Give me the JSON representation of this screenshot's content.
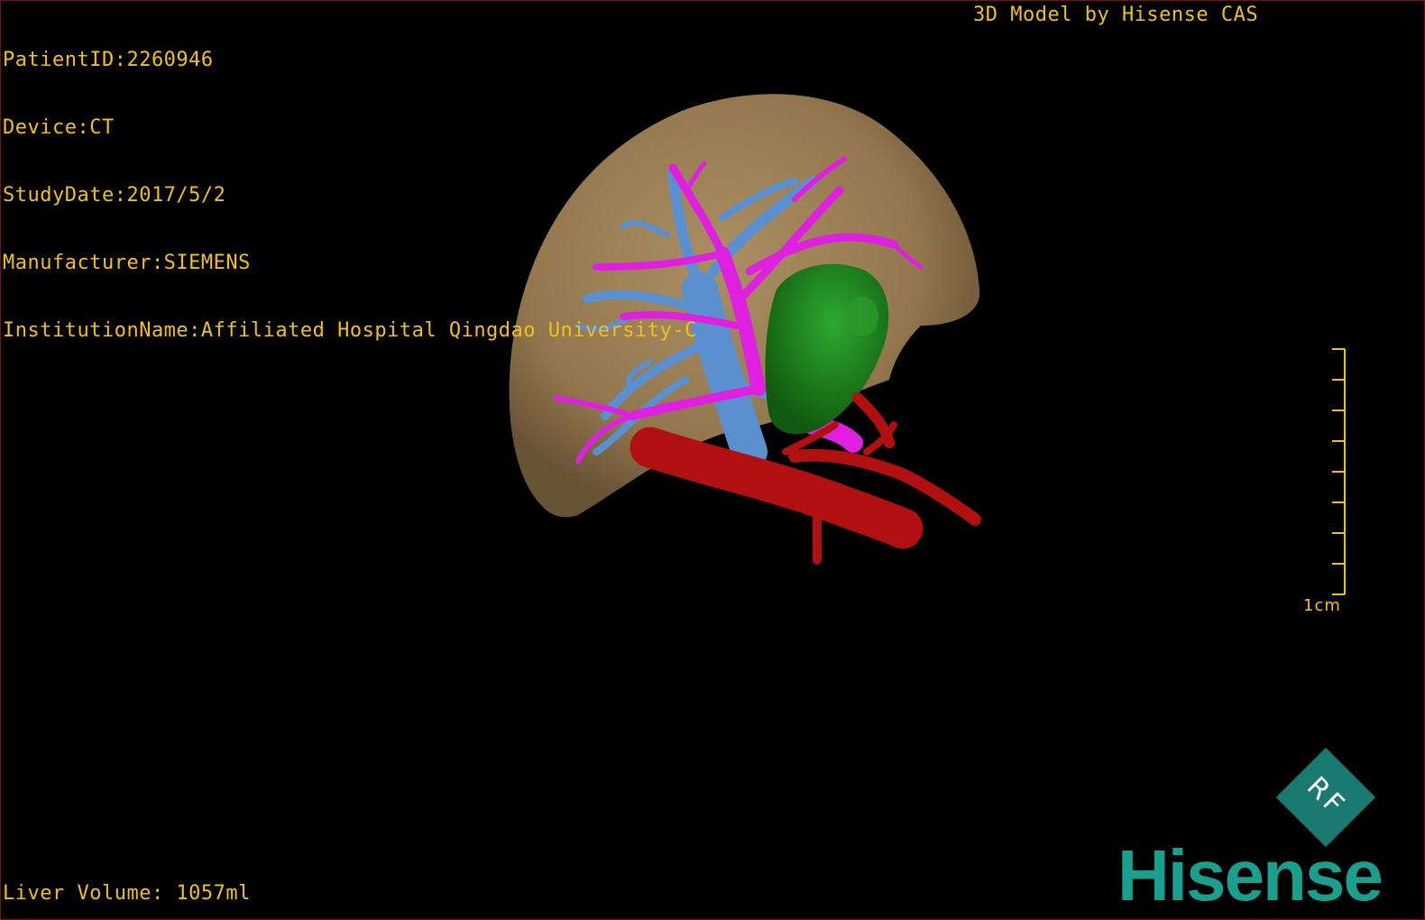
{
  "patient_info": {
    "patient_id": "PatientID:2260946",
    "device": "Device:CT",
    "study_date": "StudyDate:2017/5/2",
    "manufacturer": "Manufacturer:SIEMENS",
    "institution": "InstitutionName:Affiliated Hospital Qingdao University-C"
  },
  "watermark_top": "3D Model by Hisense CAS",
  "liver_volume": "Liver Volume: 1057ml",
  "scale_bar": {
    "label": "1cm",
    "tick_count": 9
  },
  "brand": {
    "name": "Hisense",
    "badge_text": "RF"
  },
  "colors": {
    "overlay_text": "#f0c020",
    "liver": "#a88a5e",
    "portal_vein": "#5a8fd0",
    "hepatic_vein": "#e020e0",
    "tumor": "#1f8a1f",
    "artery": "#b01010",
    "brand": "#1a9e8e"
  },
  "model_structures": [
    "liver",
    "portal-vein",
    "hepatic-vein",
    "tumor",
    "artery"
  ]
}
